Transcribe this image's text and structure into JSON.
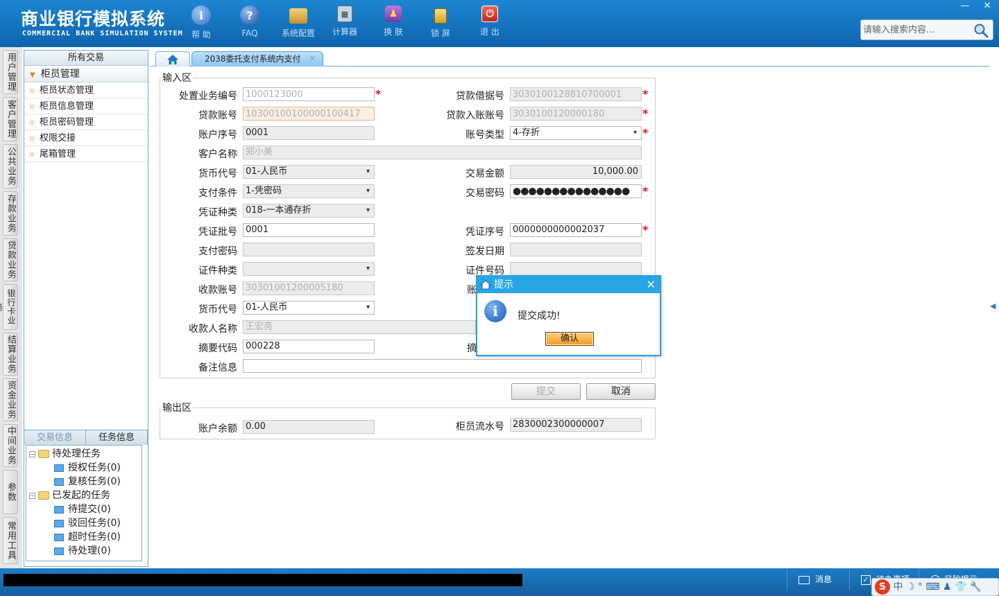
{
  "header": {
    "title_cn": "商业银行模拟系统",
    "title_en": "COMMERCIAL BANK SIMULATION SYSTEM",
    "tools": [
      {
        "label": "帮 助",
        "icon": "info-icon"
      },
      {
        "label": "FAQ",
        "icon": "help-icon"
      },
      {
        "label": "系统配置",
        "icon": "config-icon"
      },
      {
        "label": "计算器",
        "icon": "calculator-icon"
      },
      {
        "label": "换 肤",
        "icon": "skin-icon"
      },
      {
        "label": "锁 屏",
        "icon": "lock-icon"
      },
      {
        "label": "退 出",
        "icon": "power-icon"
      }
    ],
    "minimize": "—",
    "close": "✕",
    "search_placeholder": "请输入搜索内容..."
  },
  "vtabs": [
    "用户管理",
    "客户管理",
    "公共业务",
    "存款业务",
    "贷款业务",
    "银行卡业务",
    "结算业务",
    "资金业务",
    "中间业务",
    "参数",
    "常用工具"
  ],
  "leftpanel": {
    "all_transactions": "所有交易",
    "group": "柜员管理",
    "items": [
      "柜员状态管理",
      "柜员信息管理",
      "柜员密码管理",
      "权限交接",
      "尾箱管理"
    ],
    "tabs": [
      "交易信息",
      "任务信息"
    ],
    "tree": {
      "pending": "待处理任务",
      "pending_children": [
        "授权任务(0)",
        "复核任务(0)"
      ],
      "initiated": "已发起的任务",
      "initiated_children": [
        "待提交(0)",
        "驳回任务(0)",
        "超时任务(0)",
        "待处理(0)"
      ]
    }
  },
  "tabs": {
    "home_icon": "home-icon",
    "active": "2038委托支付系统内支付",
    "close": "✕"
  },
  "input_area": {
    "legend": "输入区",
    "fields": {
      "disposal_no": {
        "label": "处置业务编号",
        "value": "1000123000"
      },
      "loan_receipt_no": {
        "label": "贷款借据号",
        "value": "3030100128810700001"
      },
      "loan_account": {
        "label": "贷款账号",
        "value": "10300100100000100417"
      },
      "loan_entry_account": {
        "label": "贷款入账账号",
        "value": "3030100120000180"
      },
      "account_seq": {
        "label": "账户序号",
        "value": "0001"
      },
      "account_type": {
        "label": "账号类型",
        "value": "4-存折"
      },
      "customer_name": {
        "label": "客户名称",
        "value": "郑小美"
      },
      "currency": {
        "label": "货币代号",
        "value": "01-人民币"
      },
      "amount": {
        "label": "交易金额",
        "value": "10,000.00"
      },
      "pay_condition": {
        "label": "支付条件",
        "value": "1-凭密码"
      },
      "tx_password": {
        "label": "交易密码",
        "value": "●●●●●●●●●●●●●●●"
      },
      "voucher_type": {
        "label": "凭证种类",
        "value": "018-一本通存折"
      },
      "voucher_batch": {
        "label": "凭证批号",
        "value": "0001"
      },
      "voucher_seq": {
        "label": "凭证序号",
        "value": "0000000000002037"
      },
      "pay_password": {
        "label": "支付密码",
        "value": ""
      },
      "issue_date": {
        "label": "签发日期",
        "value": ""
      },
      "id_type": {
        "label": "证件种类",
        "value": ""
      },
      "id_no": {
        "label": "证件号码",
        "value": ""
      },
      "payee_account": {
        "label": "收款账号",
        "value": "30301001200005180"
      },
      "payee_account_partial": {
        "label": "账",
        "value": ""
      },
      "currency2": {
        "label": "货币代号",
        "value": "01-人民币"
      },
      "payee_name": {
        "label": "收款人名称",
        "value": "王宏亮"
      },
      "summary_code": {
        "label": "摘要代码",
        "value": "000228"
      },
      "summary_partial": {
        "label": "摘",
        "value": ""
      },
      "remark": {
        "label": "备注信息",
        "value": ""
      }
    },
    "submit": "提交",
    "cancel": "取消"
  },
  "output_area": {
    "legend": "输出区",
    "balance": {
      "label": "账户余额",
      "value": "0.00"
    },
    "teller_serial": {
      "label": "柜员流水号",
      "value": "2830002300000007"
    }
  },
  "dialog": {
    "title": "提示",
    "message": "提交成功!",
    "ok": "确认"
  },
  "statusbar": {
    "messages": "消息",
    "todo": "待办事项",
    "risk": "风险提示"
  },
  "ime": {
    "text": "中 ☽ ° ⌨ ♟ 👕 🔧",
    "logo": "S"
  },
  "colors": {
    "header": "#1472bd",
    "accent": "#2ba0e0",
    "required": "#d21b1b"
  }
}
